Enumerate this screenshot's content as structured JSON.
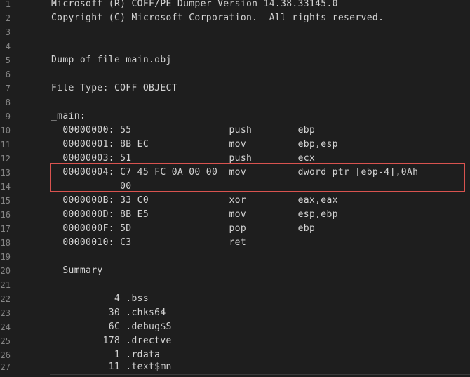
{
  "editor": {
    "lines": [
      {
        "n": "1",
        "text": "Microsoft (R) COFF/PE Dumper Version 14.38.33145.0"
      },
      {
        "n": "2",
        "text": "Copyright (C) Microsoft Corporation.  All rights reserved."
      },
      {
        "n": "3",
        "text": ""
      },
      {
        "n": "4",
        "text": ""
      },
      {
        "n": "5",
        "text": "Dump of file main.obj"
      },
      {
        "n": "6",
        "text": ""
      },
      {
        "n": "7",
        "text": "File Type: COFF OBJECT"
      },
      {
        "n": "8",
        "text": ""
      },
      {
        "n": "9",
        "text": "_main:"
      },
      {
        "n": "10",
        "text": "  00000000: 55                 push        ebp"
      },
      {
        "n": "11",
        "text": "  00000001: 8B EC              mov         ebp,esp"
      },
      {
        "n": "12",
        "text": "  00000003: 51                 push        ecx"
      },
      {
        "n": "13",
        "text": "  00000004: C7 45 FC 0A 00 00  mov         dword ptr [ebp-4],0Ah"
      },
      {
        "n": "14",
        "text": "            00"
      },
      {
        "n": "15",
        "text": "  0000000B: 33 C0              xor         eax,eax"
      },
      {
        "n": "16",
        "text": "  0000000D: 8B E5              mov         esp,ebp"
      },
      {
        "n": "17",
        "text": "  0000000F: 5D                 pop         ebp"
      },
      {
        "n": "18",
        "text": "  00000010: C3                 ret"
      },
      {
        "n": "19",
        "text": ""
      },
      {
        "n": "20",
        "text": "  Summary"
      },
      {
        "n": "21",
        "text": ""
      },
      {
        "n": "22",
        "text": "           4 .bss"
      },
      {
        "n": "23",
        "text": "          30 .chks64"
      },
      {
        "n": "24",
        "text": "          6C .debug$S"
      },
      {
        "n": "25",
        "text": "         178 .drectve"
      },
      {
        "n": "26",
        "text": "           1 .rdata"
      },
      {
        "n": "27",
        "text": "          11 .text$mn"
      }
    ]
  },
  "colors": {
    "background": "#1e1e1e",
    "text": "#d4d4d4",
    "line_number": "#858585",
    "highlight_border": "#d9534f"
  }
}
